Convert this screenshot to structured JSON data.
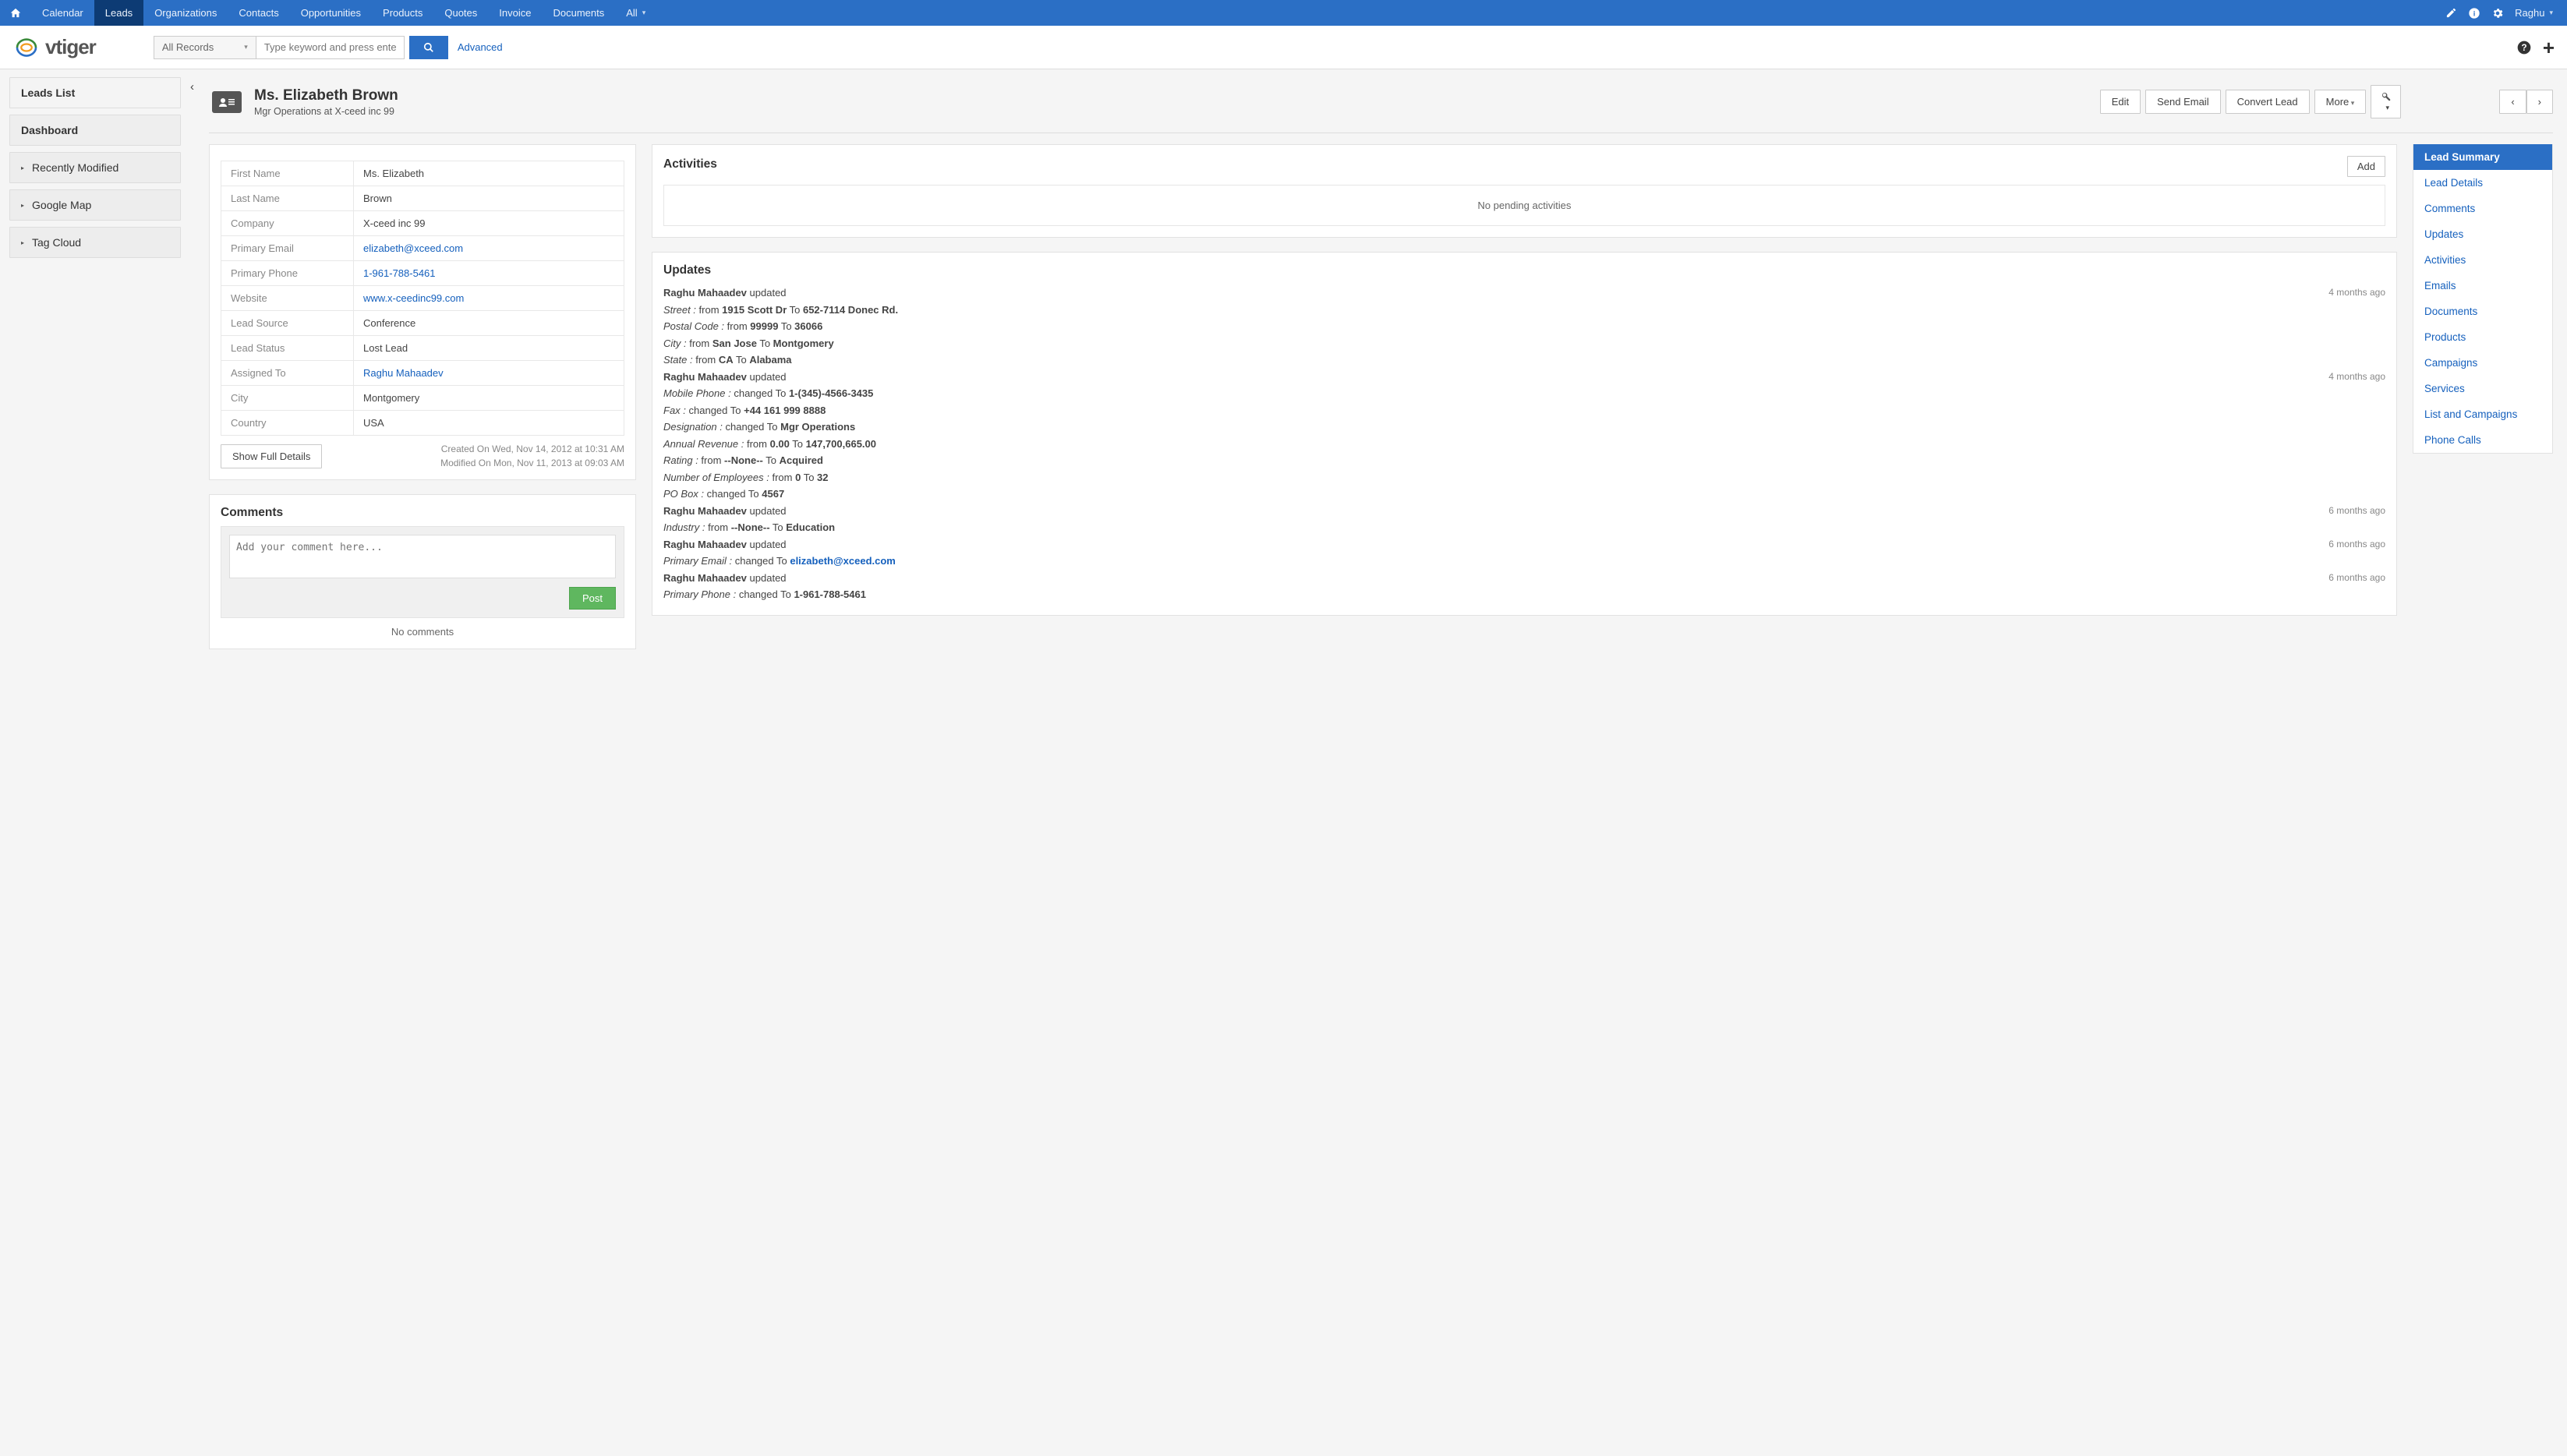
{
  "nav": {
    "items": [
      "Calendar",
      "Leads",
      "Organizations",
      "Contacts",
      "Opportunities",
      "Products",
      "Quotes",
      "Invoice",
      "Documents",
      "All"
    ],
    "active": "Leads",
    "user": "Raghu"
  },
  "search": {
    "scope": "All Records",
    "placeholder": "Type keyword and press enter",
    "advanced": "Advanced"
  },
  "sidebar": {
    "list_label": "Leads List",
    "dashboard_label": "Dashboard",
    "widgets": [
      "Recently Modified",
      "Google Map",
      "Tag Cloud"
    ]
  },
  "record": {
    "title": "Ms. Elizabeth Brown",
    "subtitle": "Mgr Operations at X-ceed inc 99",
    "actions": {
      "edit": "Edit",
      "send_email": "Send Email",
      "convert": "Convert Lead",
      "more": "More"
    }
  },
  "details": {
    "rows": [
      {
        "label": "First Name",
        "value": "Ms. Elizabeth",
        "link": false
      },
      {
        "label": "Last Name",
        "value": "Brown",
        "link": false
      },
      {
        "label": "Company",
        "value": "X-ceed inc 99",
        "link": false
      },
      {
        "label": "Primary Email",
        "value": "elizabeth@xceed.com",
        "link": true
      },
      {
        "label": "Primary Phone",
        "value": "1-961-788-5461",
        "link": true
      },
      {
        "label": "Website",
        "value": "www.x-ceedinc99.com",
        "link": true
      },
      {
        "label": "Lead Source",
        "value": "Conference",
        "link": false
      },
      {
        "label": "Lead Status",
        "value": "Lost Lead",
        "link": false
      },
      {
        "label": "Assigned To",
        "value": "Raghu Mahaadev",
        "link": true
      },
      {
        "label": "City",
        "value": "Montgomery",
        "link": false
      },
      {
        "label": "Country",
        "value": "USA",
        "link": false
      }
    ],
    "created": "Created On Wed, Nov 14, 2012 at 10:31 AM",
    "modified": "Modified On Mon, Nov 11, 2013 at 09:03 AM",
    "show_full": "Show Full Details"
  },
  "comments": {
    "title": "Comments",
    "placeholder": "Add your comment here...",
    "post": "Post",
    "empty": "No comments"
  },
  "activities": {
    "title": "Activities",
    "add": "Add",
    "empty": "No pending activities"
  },
  "updates": {
    "title": "Updates",
    "groups": [
      {
        "actor": "Raghu Mahaadev",
        "verb": "updated",
        "time": "4 months ago",
        "lines": [
          {
            "field": "Street",
            "text_prefix": "from",
            "from": "1915 Scott Dr",
            "mid": "To",
            "to": "652-7114 Donec Rd."
          },
          {
            "field": "Postal Code",
            "text_prefix": "from",
            "from": "99999",
            "mid": "To",
            "to": "36066"
          },
          {
            "field": "City",
            "text_prefix": "from",
            "from": "San Jose",
            "mid": "To",
            "to": "Montgomery"
          },
          {
            "field": "State",
            "text_prefix": "from",
            "from": "CA",
            "mid": "To",
            "to": "Alabama"
          }
        ]
      },
      {
        "actor": "Raghu Mahaadev",
        "verb": "updated",
        "time": "4 months ago",
        "lines": [
          {
            "field": "Mobile Phone",
            "text_prefix": "changed To",
            "to": "1-(345)-4566-3435"
          },
          {
            "field": "Fax",
            "text_prefix": "changed To",
            "to": "+44 161 999 8888"
          },
          {
            "field": "Designation",
            "text_prefix": "changed To",
            "to": "Mgr Operations"
          },
          {
            "field": "Annual Revenue",
            "text_prefix": "from",
            "from": "0.00",
            "mid": "To",
            "to": "147,700,665.00"
          },
          {
            "field": "Rating",
            "text_prefix": "from",
            "from": "--None--",
            "mid": "To",
            "to": "Acquired"
          },
          {
            "field": "Number of Employees",
            "text_prefix": "from",
            "from": "0",
            "mid": "To",
            "to": "32"
          },
          {
            "field": "PO Box",
            "text_prefix": "changed To",
            "to": "4567"
          }
        ]
      },
      {
        "actor": "Raghu Mahaadev",
        "verb": "updated",
        "time": "6 months ago",
        "lines": [
          {
            "field": "Industry",
            "text_prefix": "from",
            "from": "--None--",
            "mid": "To",
            "to": "Education"
          }
        ]
      },
      {
        "actor": "Raghu Mahaadev",
        "verb": "updated",
        "time": "6 months ago",
        "lines": [
          {
            "field": "Primary Email",
            "text_prefix": "changed To",
            "to": "elizabeth@xceed.com",
            "to_link": true
          }
        ]
      },
      {
        "actor": "Raghu Mahaadev",
        "verb": "updated",
        "time": "6 months ago",
        "lines": [
          {
            "field": "Primary Phone",
            "text_prefix": "changed To",
            "to": "1-961-788-5461"
          }
        ]
      }
    ]
  },
  "righttabs": {
    "items": [
      "Lead Summary",
      "Lead Details",
      "Comments",
      "Updates",
      "Activities",
      "Emails",
      "Documents",
      "Products",
      "Campaigns",
      "Services",
      "List and Campaigns",
      "Phone Calls"
    ],
    "active": "Lead Summary"
  }
}
